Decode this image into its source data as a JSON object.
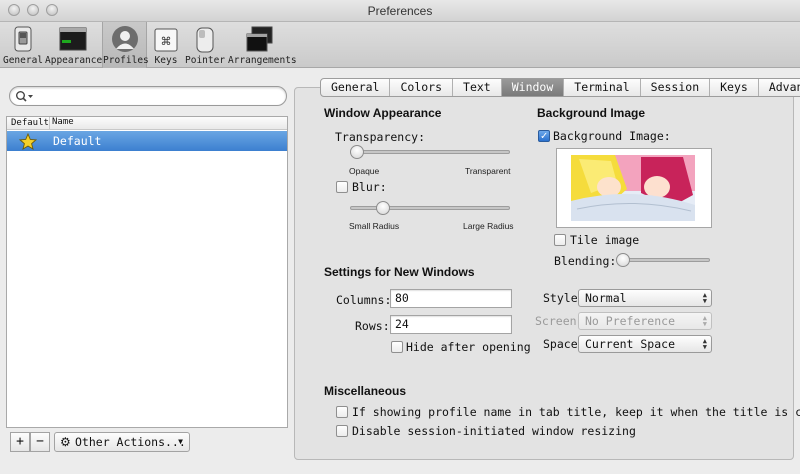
{
  "window": {
    "title": "Preferences"
  },
  "toolbar": {
    "items": [
      {
        "label": "General",
        "icon": "general-switch-icon"
      },
      {
        "label": "Appearance",
        "icon": "appearance-monitor-icon"
      },
      {
        "label": "Profiles",
        "icon": "profiles-user-icon"
      },
      {
        "label": "Keys",
        "icon": "keys-command-icon"
      },
      {
        "label": "Pointer",
        "icon": "pointer-mouse-icon"
      },
      {
        "label": "Arrangements",
        "icon": "arrangements-windows-icon"
      }
    ],
    "selected": "Profiles"
  },
  "profiles": {
    "search_placeholder": "",
    "columns": [
      "Default",
      "Name"
    ],
    "rows": [
      {
        "name": "Default",
        "is_default": true,
        "selected": true
      }
    ],
    "add_label": "+",
    "remove_label": "−",
    "actions_label": "Other Actions..."
  },
  "tabs": {
    "items": [
      "General",
      "Colors",
      "Text",
      "Window",
      "Terminal",
      "Session",
      "Keys",
      "Advanced"
    ],
    "selected": "Window"
  },
  "window_appearance": {
    "heading": "Window Appearance",
    "transparency_label": "Transparency:",
    "transparency_min": "Opaque",
    "transparency_max": "Transparent",
    "transparency_value": 0.0,
    "blur_label": "Blur:",
    "blur_checked": false,
    "blur_min": "Small Radius",
    "blur_max": "Large Radius",
    "blur_value": 0.18
  },
  "background_image": {
    "heading": "Background Image",
    "checkbox_label": "Background Image:",
    "checked": true,
    "tile_label": "Tile image",
    "tile_checked": false,
    "blending_label": "Blending:",
    "blending_value": 0.0
  },
  "new_windows": {
    "heading": "Settings for New Windows",
    "columns_label": "Columns:",
    "columns_value": "80",
    "rows_label": "Rows:",
    "rows_value": "24",
    "hide_label": "Hide after opening",
    "hide_checked": false,
    "style_label": "Style:",
    "style_value": "Normal",
    "screen_label": "Screen:",
    "screen_value": "No Preference",
    "space_label": "Space:",
    "space_value": "Current Space"
  },
  "misc": {
    "heading": "Miscellaneous",
    "opt1_label": "If showing profile name in tab title, keep it when the title is cha",
    "opt1_checked": false,
    "opt2_label": "Disable session-initiated window resizing",
    "opt2_checked": false
  }
}
